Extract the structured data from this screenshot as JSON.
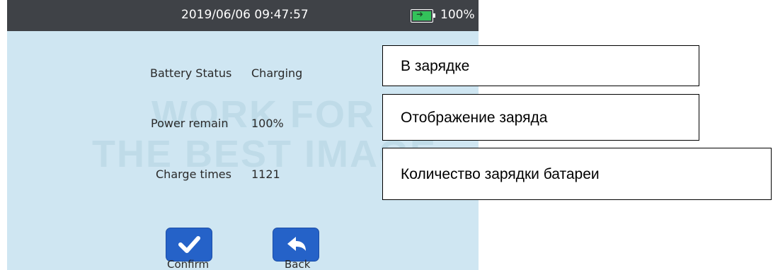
{
  "status_bar": {
    "datetime": "2019/06/06 09:47:57",
    "battery_percent": "100%",
    "battery_icon": "battery-charging-icon"
  },
  "watermark": {
    "line1": "WORK FOR",
    "line2": "THE BEST IMAGE"
  },
  "rows": [
    {
      "label": "Battery Status",
      "value": "Charging"
    },
    {
      "label": "Power remain",
      "value": "100%"
    },
    {
      "label": "Charge times",
      "value": "1121"
    }
  ],
  "buttons": {
    "confirm": {
      "label": "Confirm",
      "icon": "checkmark-icon"
    },
    "back": {
      "label": "Back",
      "icon": "back-arrow-icon"
    }
  },
  "callouts": [
    "В зарядке",
    "Отображение заряда",
    "Количество зарядки батареи"
  ],
  "colors": {
    "background": "#cfe6f2",
    "status_bar": "#3f4247",
    "button": "#2562c8",
    "battery_fill": "#33c25a"
  }
}
